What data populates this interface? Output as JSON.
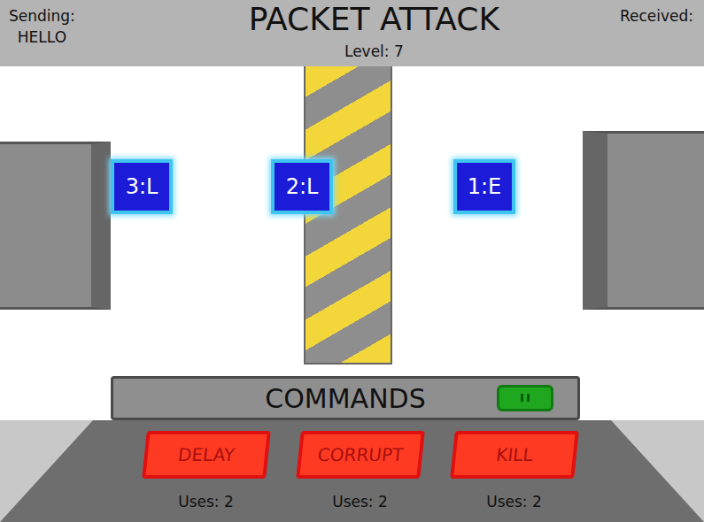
{
  "header": {
    "sending_label": "Sending:",
    "sending_value": "HELLO",
    "title": "PACKET ATTACK",
    "level": "Level: 7",
    "received_label": "Received:"
  },
  "packets": [
    {
      "label": "3:L"
    },
    {
      "label": "2:L"
    },
    {
      "label": "1:E"
    }
  ],
  "commands": {
    "title": "COMMANDS",
    "buttons": [
      {
        "label": "DELAY",
        "uses": "Uses: 2"
      },
      {
        "label": "CORRUPT",
        "uses": "Uses: 2"
      },
      {
        "label": "KILL",
        "uses": "Uses: 2"
      }
    ]
  }
}
